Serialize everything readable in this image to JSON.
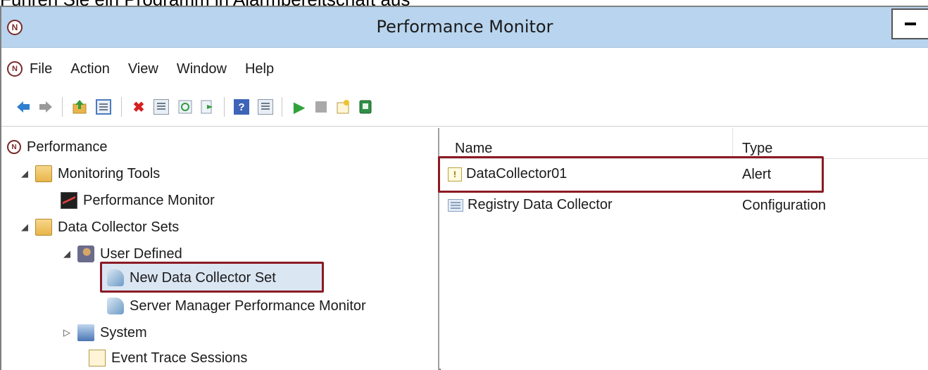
{
  "caption": "Führen Sie ein Programm in Alarmbereitschaft aus",
  "window": {
    "title": "Performance Monitor",
    "app_icon_glyph": "N"
  },
  "menu": {
    "items": [
      "File",
      "Action",
      "View",
      "Window",
      "Help"
    ]
  },
  "toolbar": {
    "buttons": [
      {
        "icon": "back-arrow-icon"
      },
      {
        "icon": "forward-arrow-icon"
      },
      {
        "icon": "up-folder-icon"
      },
      {
        "icon": "show-hide-console-tree-icon"
      },
      {
        "icon": "delete-icon"
      },
      {
        "icon": "properties-icon"
      },
      {
        "icon": "refresh-icon"
      },
      {
        "icon": "export-list-icon"
      },
      {
        "icon": "help-icon"
      },
      {
        "icon": "show-hide-action-pane-icon"
      },
      {
        "icon": "start-icon"
      },
      {
        "icon": "stop-icon"
      },
      {
        "icon": "new-data-collector-icon"
      },
      {
        "icon": "latest-report-icon"
      }
    ],
    "help_glyph": "?",
    "delete_glyph": "✖",
    "start_glyph": "▶"
  },
  "tree": {
    "root": "Performance",
    "monitoring_tools": "Monitoring Tools",
    "performance_monitor": "Performance Monitor",
    "data_collector_sets": "Data Collector Sets",
    "user_defined": "User Defined",
    "new_data_collector_set": "New Data Collector Set",
    "server_manager_perf_monitor": "Server Manager Performance Monitor",
    "system": "System",
    "event_trace_sessions": "Event Trace Sessions",
    "expanded_glyph": "◢",
    "collapsed_glyph": "▷"
  },
  "list": {
    "columns": {
      "name": "Name",
      "type": "Type"
    },
    "rows": [
      {
        "name": "DataCollector01",
        "type": "Alert",
        "icon": "alert-collector-icon"
      },
      {
        "name": "Registry Data Collector",
        "type": "Configuration",
        "icon": "registry-collector-icon"
      }
    ],
    "alert_glyph": "!"
  },
  "colors": {
    "titlebar": "#b8d4ee",
    "highlight_border": "#8b1a24",
    "selection_background": "#dbe6f3"
  }
}
